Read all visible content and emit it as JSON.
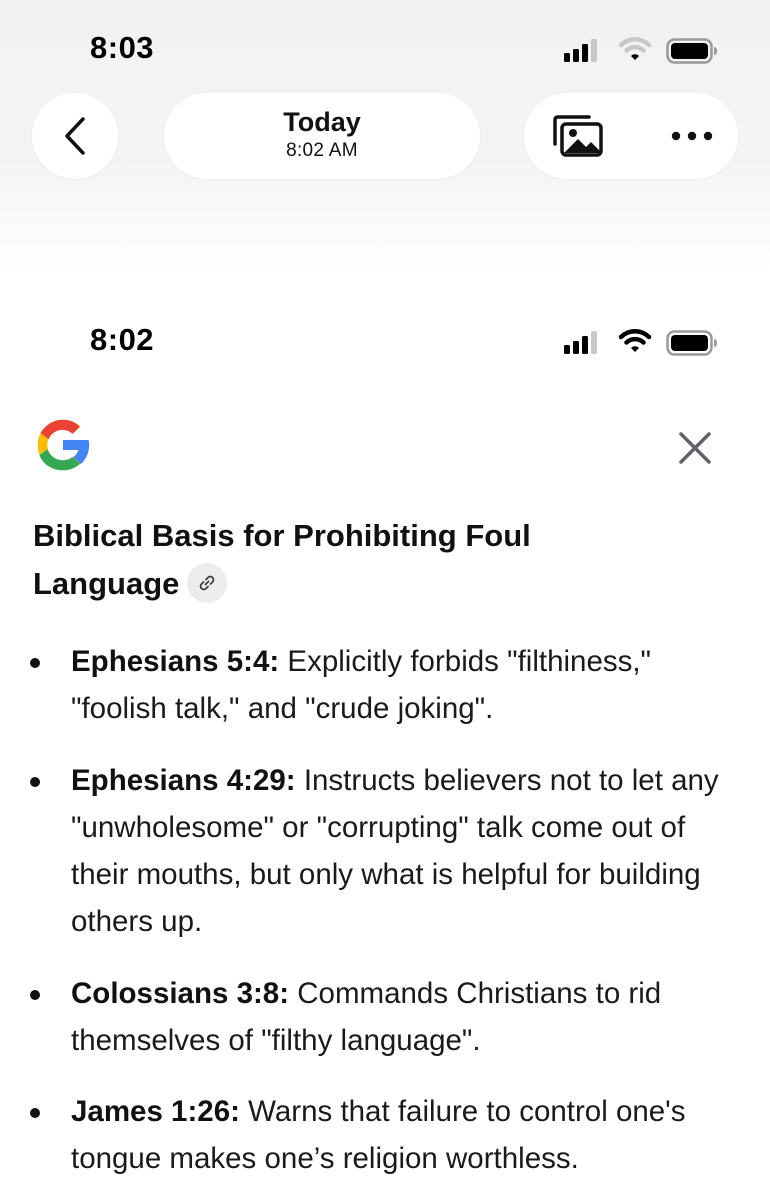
{
  "viewer": {
    "status_time": "8:03",
    "title": "Today",
    "subtitle": "8:02 AM"
  },
  "screenshot": {
    "status_time": "8:02",
    "heading": "Biblical Basis for Prohibiting Foul Language",
    "items": [
      {
        "ref": "Ephesians 5:4:",
        "text": "Explicitly forbids \"filthiness,\" \"foolish talk,\" and \"crude joking\"."
      },
      {
        "ref": "Ephesians 4:29:",
        "text": "Instructs believers not to let any \"unwholesome\" or \"corrupting\" talk come out of their mouths, but only what is helpful for building others up."
      },
      {
        "ref": "Colossians 3:8:",
        "text": "Commands Christians to rid themselves of \"filthy language\"."
      },
      {
        "ref": "James 1:26:",
        "text": "Warns that failure to control one's tongue makes one’s religion worthless."
      }
    ]
  },
  "icons": {
    "back": "chevron-left-icon",
    "gallery": "photo-gallery-icon",
    "more": "more-horizontal-icon",
    "close": "close-icon",
    "link": "link-icon",
    "logo": "google-logo"
  },
  "colors": {
    "google_blue": "#4285F4",
    "google_red": "#EA4335",
    "google_yellow": "#FBBC05",
    "google_green": "#34A853",
    "close_gray": "#5f6368"
  }
}
